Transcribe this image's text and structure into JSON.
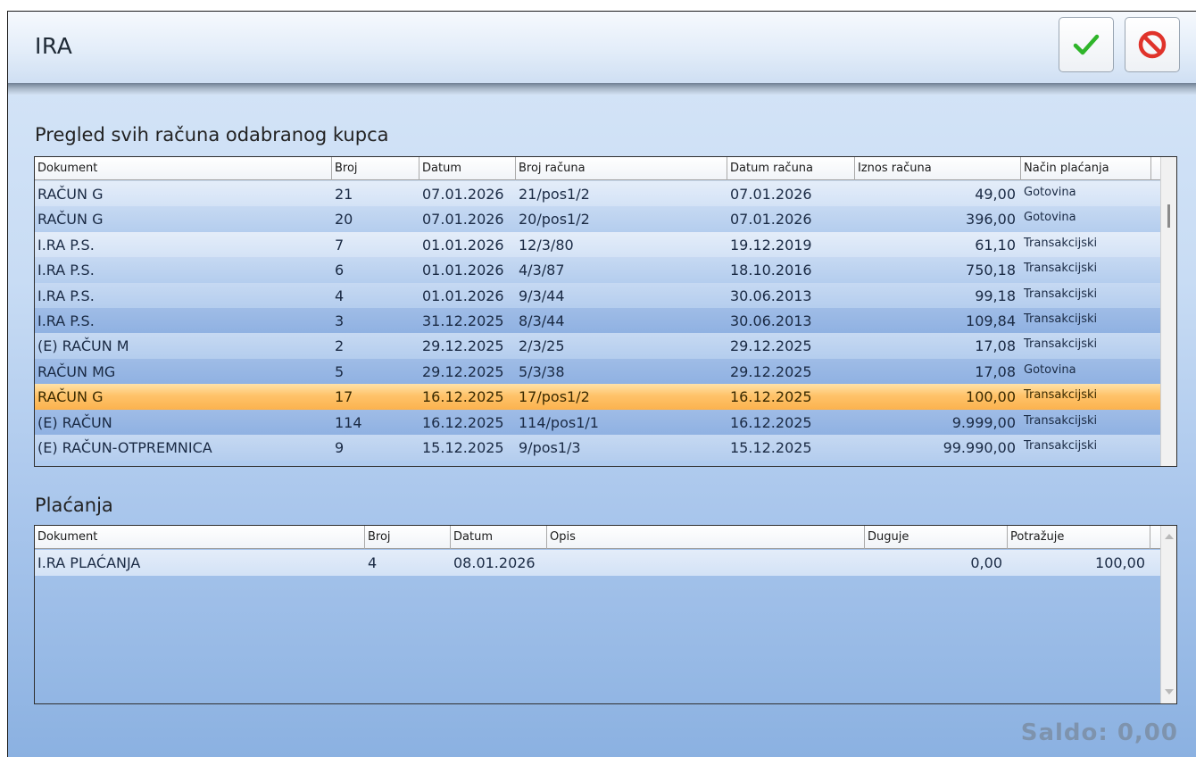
{
  "window": {
    "title": "IRA",
    "ok_icon": "checkmark-icon",
    "cancel_icon": "no-entry-icon"
  },
  "invoices": {
    "title": "Pregled svih računa odabranog kupca",
    "columns": [
      "Dokument",
      "Broj",
      "Datum",
      "Broj računa",
      "Datum računa",
      "Iznos računa",
      "Način plaćanja"
    ],
    "rows": [
      [
        "RAČUN G",
        "21",
        "07.01.2026",
        "21/pos1/2",
        "07.01.2026",
        "49,00",
        "Gotovina"
      ],
      [
        "RAČUN G",
        "20",
        "07.01.2026",
        "20/pos1/2",
        "07.01.2026",
        "396,00",
        "Gotovina"
      ],
      [
        "I.RA P.S.",
        "7",
        "01.01.2026",
        "12/3/80",
        "19.12.2019",
        "61,10",
        "Transakcijski"
      ],
      [
        "I.RA P.S.",
        "6",
        "01.01.2026",
        "4/3/87",
        "18.10.2016",
        "750,18",
        "Transakcijski"
      ],
      [
        "I.RA P.S.",
        "4",
        "01.01.2026",
        "9/3/44",
        "30.06.2013",
        "99,18",
        "Transakcijski"
      ],
      [
        "I.RA P.S.",
        "3",
        "31.12.2025",
        "8/3/44",
        "30.06.2013",
        "109,84",
        "Transakcijski"
      ],
      [
        "(E) RAČUN M",
        "2",
        "29.12.2025",
        "2/3/25",
        "29.12.2025",
        "17,08",
        "Transakcijski"
      ],
      [
        "RAČUN MG",
        "5",
        "29.12.2025",
        "5/3/38",
        "29.12.2025",
        "17,08",
        "Gotovina"
      ],
      [
        "RAČUN G",
        "17",
        "16.12.2025",
        "17/pos1/2",
        "16.12.2025",
        "100,00",
        "Transakcijski"
      ],
      [
        "(E) RAČUN",
        "114",
        "16.12.2025",
        "114/pos1/1",
        "16.12.2025",
        "9.999,00",
        "Transakcijski"
      ],
      [
        "(E) RAČUN-OTPREMNICA",
        "9",
        "15.12.2025",
        "9/pos1/3",
        "15.12.2025",
        "99.990,00",
        "Transakcijski"
      ]
    ],
    "selected_row": 8
  },
  "payments": {
    "title": "Plaćanja",
    "columns": [
      "Dokument",
      "Broj",
      "Datum",
      "Opis",
      "Duguje",
      "Potražuje"
    ],
    "rows": [
      [
        "I.RA PLAĆANJA",
        "4",
        "08.01.2026",
        "",
        "0,00",
        "100,00"
      ]
    ]
  },
  "saldo": "Saldo: 0,00"
}
